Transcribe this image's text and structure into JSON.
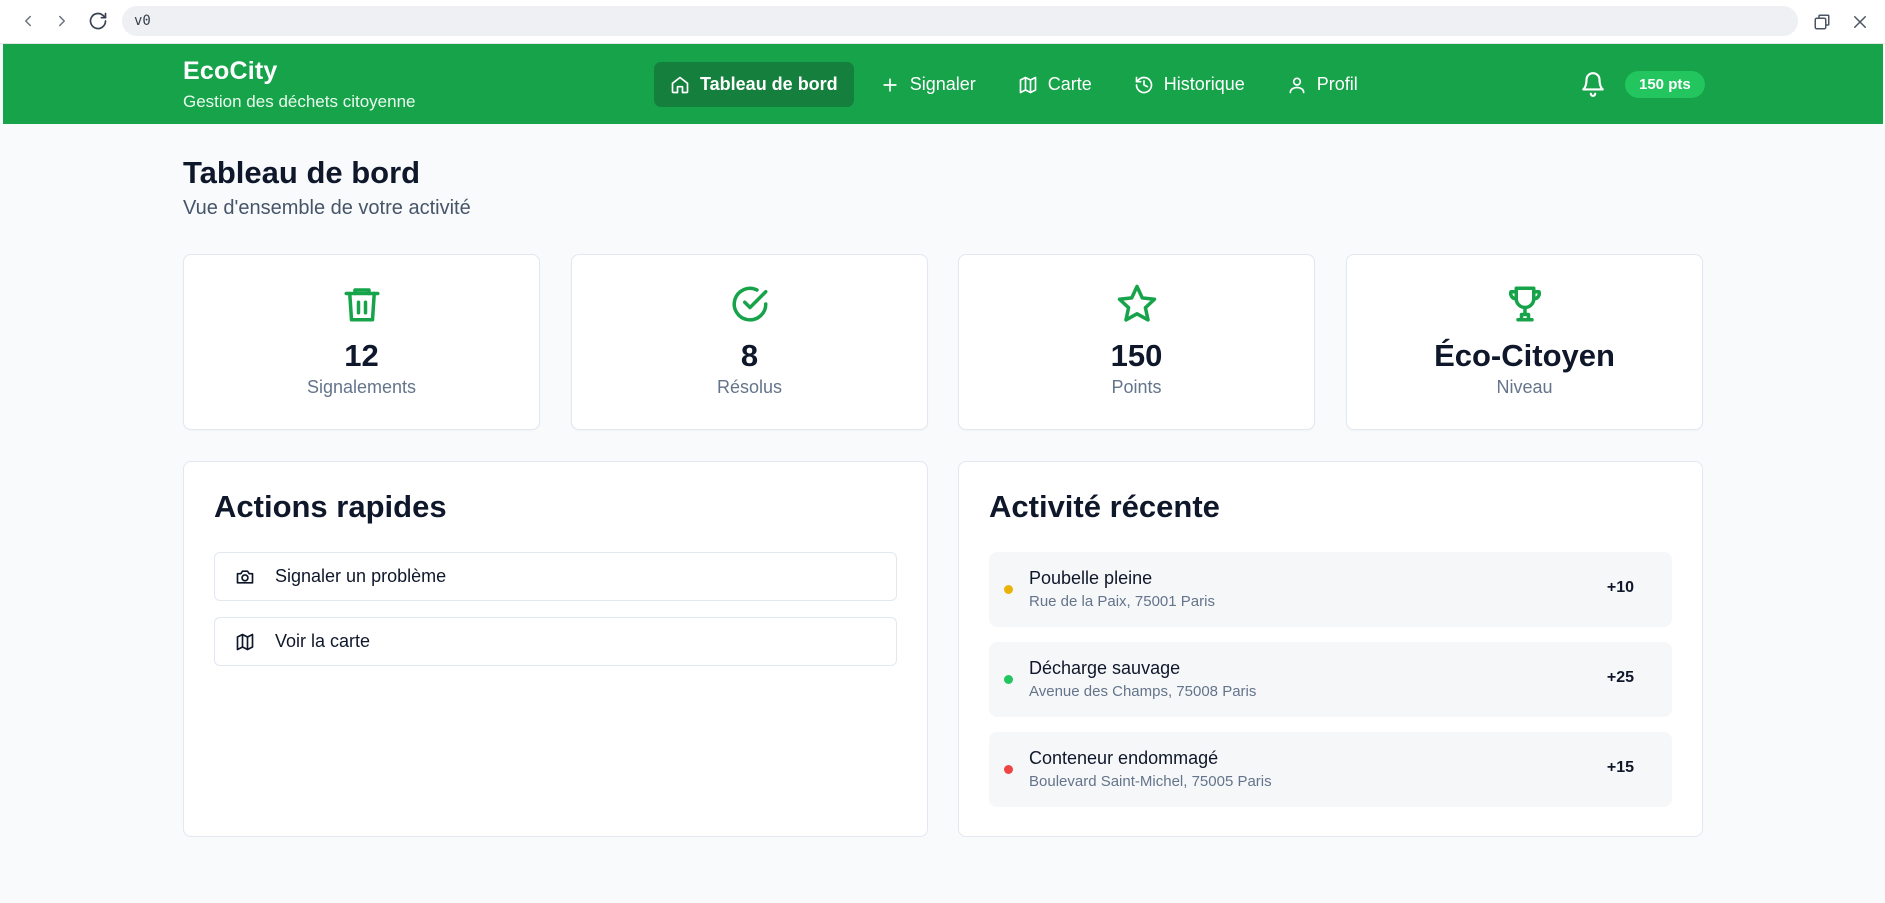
{
  "browser": {
    "url": "v0"
  },
  "header": {
    "app_name": "EcoCity",
    "tagline": "Gestion des déchets citoyenne",
    "nav": [
      {
        "label": "Tableau de bord",
        "icon": "home-icon",
        "active": true
      },
      {
        "label": "Signaler",
        "icon": "plus-icon",
        "active": false
      },
      {
        "label": "Carte",
        "icon": "map-icon",
        "active": false
      },
      {
        "label": "Historique",
        "icon": "history-icon",
        "active": false
      },
      {
        "label": "Profil",
        "icon": "user-icon",
        "active": false
      }
    ],
    "points_badge": "150 pts"
  },
  "main": {
    "title": "Tableau de bord",
    "subtitle": "Vue d'ensemble de votre activité",
    "stats": [
      {
        "value": "12",
        "label": "Signalements",
        "icon": "trash-icon"
      },
      {
        "value": "8",
        "label": "Résolus",
        "icon": "check-circle-icon"
      },
      {
        "value": "150",
        "label": "Points",
        "icon": "star-icon"
      },
      {
        "value": "Éco-Citoyen",
        "label": "Niveau",
        "icon": "trophy-icon"
      }
    ],
    "quick_actions": {
      "title": "Actions rapides",
      "items": [
        {
          "label": "Signaler un problème",
          "icon": "camera-icon"
        },
        {
          "label": "Voir la carte",
          "icon": "map-icon"
        }
      ]
    },
    "recent_activity": {
      "title": "Activité récente",
      "items": [
        {
          "title": "Poubelle pleine",
          "address": "Rue de la Paix, 75001 Paris",
          "points": "+10",
          "status_color": "#eab308"
        },
        {
          "title": "Décharge sauvage",
          "address": "Avenue des Champs, 75008 Paris",
          "points": "+25",
          "status_color": "#22c55e"
        },
        {
          "title": "Conteneur endommagé",
          "address": "Boulevard Saint-Michel, 75005 Paris",
          "points": "+15",
          "status_color": "#ef4444"
        }
      ]
    }
  },
  "colors": {
    "brand_green": "#16a34a",
    "active_nav": "#15803d",
    "badge_green": "#22c55e"
  }
}
